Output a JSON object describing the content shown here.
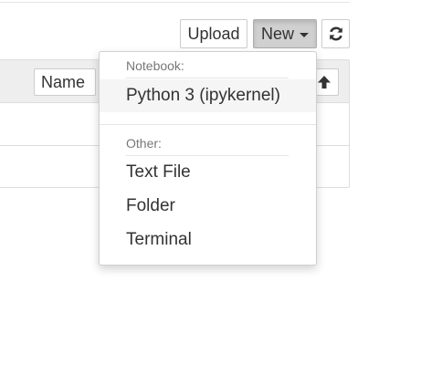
{
  "toolbar": {
    "upload_label": "Upload",
    "new_label": "New",
    "refresh_icon": "refresh-icon"
  },
  "file_list": {
    "name_header": "Name",
    "sort_icon": "arrow-up-icon"
  },
  "new_menu": {
    "sections": [
      {
        "header": "Notebook:",
        "items": [
          "Python 3 (ipykernel)"
        ]
      },
      {
        "header": "Other:",
        "items": [
          "Text File",
          "Folder",
          "Terminal"
        ]
      }
    ]
  },
  "colors": {
    "active_button_bg": "#d0d0d0",
    "menu_hover_bg": "#f5f5f5",
    "header_text": "#777777"
  }
}
